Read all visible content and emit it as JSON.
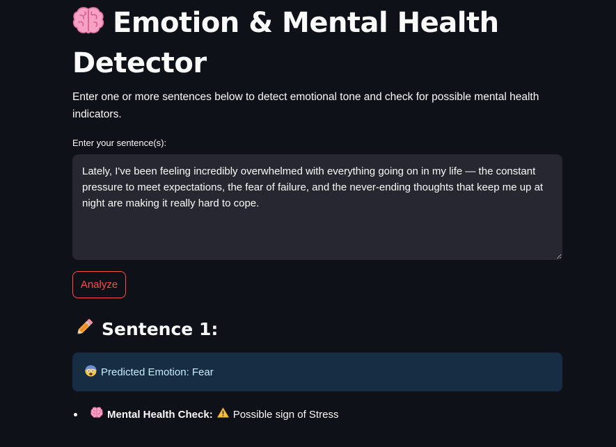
{
  "header": {
    "title": "Emotion & Mental Health Detector",
    "title_icon": "brain-icon"
  },
  "intro_text": "Enter one or more sentences below to detect emotional tone and check for possible mental health indicators.",
  "input": {
    "label": "Enter your sentence(s):",
    "value": "Lately, I've been feeling incredibly overwhelmed with everything going on in my life — the constant pressure to meet expectations, the fear of failure, and the never-ending thoughts that keep me up at night are making it really hard to cope."
  },
  "analyze_button": {
    "label": "Analyze"
  },
  "results": [
    {
      "heading": "Sentence 1:",
      "heading_icon": "pencil-icon",
      "emotion_icon": "fearful-face-icon",
      "emotion_text": "Predicted Emotion: Fear",
      "mental_health_icon": "brain-icon",
      "mental_health_label": "Mental Health Check:",
      "mental_health_status_icon": "warning-icon",
      "mental_health_value": "Possible sign of Stress"
    }
  ],
  "colors": {
    "background": "#0e1117",
    "text": "#fafafa",
    "input_background": "#262730",
    "accent": "#ff4b4b",
    "info_background": "#172d43",
    "info_text": "#c7ebff"
  }
}
